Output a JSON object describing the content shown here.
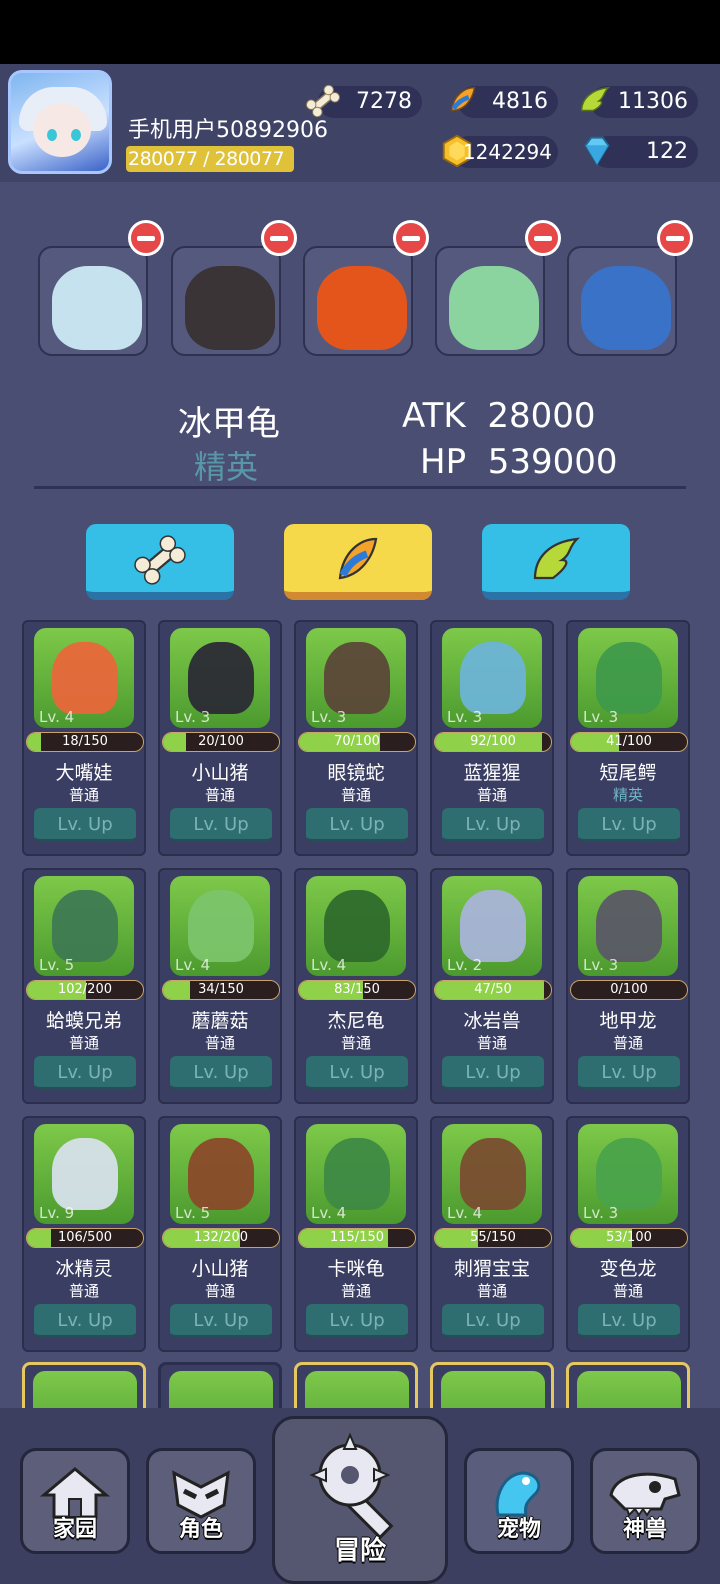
{
  "player": {
    "name": "手机用户50892906",
    "exp": "280077 / 280077"
  },
  "resources": {
    "bone": "7278",
    "feather_candy": "4816",
    "wing": "11306",
    "gold": "1242294",
    "diamond": "122"
  },
  "team": [
    {
      "name": "ice-turtle"
    },
    {
      "name": "dark-dragon"
    },
    {
      "name": "orange-dino"
    },
    {
      "name": "green-dino"
    },
    {
      "name": "hydra"
    }
  ],
  "selected_pet": {
    "name": "冰甲龟",
    "rank": "精英",
    "atk_label": "ATK",
    "atk": "28000",
    "hp_label": "HP",
    "hp": "539000"
  },
  "tabs": [
    {
      "icon": "bone-icon",
      "active": false
    },
    {
      "icon": "feather-candy-icon",
      "active": true
    },
    {
      "icon": "wing-icon",
      "active": false
    }
  ],
  "pets": [
    {
      "name": "大嘴娃",
      "rank": "普通",
      "lv": "Lv. 4",
      "progress": "18/150",
      "fill": 0.12,
      "color": "#e8673a"
    },
    {
      "name": "小山猪",
      "rank": "普通",
      "lv": "Lv. 3",
      "progress": "20/100",
      "fill": 0.2,
      "color": "#2b2b35"
    },
    {
      "name": "眼镜蛇",
      "rank": "普通",
      "lv": "Lv. 3",
      "progress": "70/100",
      "fill": 0.7,
      "color": "#5b4838"
    },
    {
      "name": "蓝猩猩",
      "rank": "普通",
      "lv": "Lv. 3",
      "progress": "92/100",
      "fill": 0.92,
      "color": "#6db4d6"
    },
    {
      "name": "短尾鳄",
      "rank": "精英",
      "lv": "Lv. 3",
      "progress": "41/100",
      "fill": 0.41,
      "color": "#3f9a4a"
    },
    {
      "name": "蛤蟆兄弟",
      "rank": "普通",
      "lv": "Lv. 5",
      "progress": "102/200",
      "fill": 0.51,
      "color": "#3e7a52"
    },
    {
      "name": "蘑蘑菇",
      "rank": "普通",
      "lv": "Lv. 4",
      "progress": "34/150",
      "fill": 0.23,
      "color": "#7cc46a"
    },
    {
      "name": "杰尼龟",
      "rank": "普通",
      "lv": "Lv. 4",
      "progress": "83/150",
      "fill": 0.55,
      "color": "#2f6b2c"
    },
    {
      "name": "冰岩兽",
      "rank": "普通",
      "lv": "Lv. 2",
      "progress": "47/50",
      "fill": 0.94,
      "color": "#a8b4d8"
    },
    {
      "name": "地甲龙",
      "rank": "普通",
      "lv": "Lv. 3",
      "progress": "0/100",
      "fill": 0.0,
      "color": "#5a5a66"
    },
    {
      "name": "冰精灵",
      "rank": "普通",
      "lv": "Lv. 9",
      "progress": "106/500",
      "fill": 0.21,
      "color": "#d6e0ea"
    },
    {
      "name": "小山猪",
      "rank": "普通",
      "lv": "Lv. 5",
      "progress": "132/200",
      "fill": 0.66,
      "color": "#8a4a2a"
    },
    {
      "name": "卡咪龟",
      "rank": "普通",
      "lv": "Lv. 4",
      "progress": "115/150",
      "fill": 0.77,
      "color": "#3f8a44"
    },
    {
      "name": "刺猬宝宝",
      "rank": "普通",
      "lv": "Lv. 4",
      "progress": "55/150",
      "fill": 0.37,
      "color": "#7a4e30"
    },
    {
      "name": "变色龙",
      "rank": "普通",
      "lv": "Lv. 3",
      "progress": "53/100",
      "fill": 0.53,
      "color": "#4aa34a"
    }
  ],
  "lvup_label": "Lv. Up",
  "nav": [
    {
      "label": "家园",
      "icon": "home-icon"
    },
    {
      "label": "角色",
      "icon": "character-mask-icon"
    },
    {
      "label": "冒险",
      "icon": "adventure-mace-icon"
    },
    {
      "label": "宠物",
      "icon": "pet-frog-icon"
    },
    {
      "label": "神兽",
      "icon": "beast-skull-icon"
    }
  ]
}
